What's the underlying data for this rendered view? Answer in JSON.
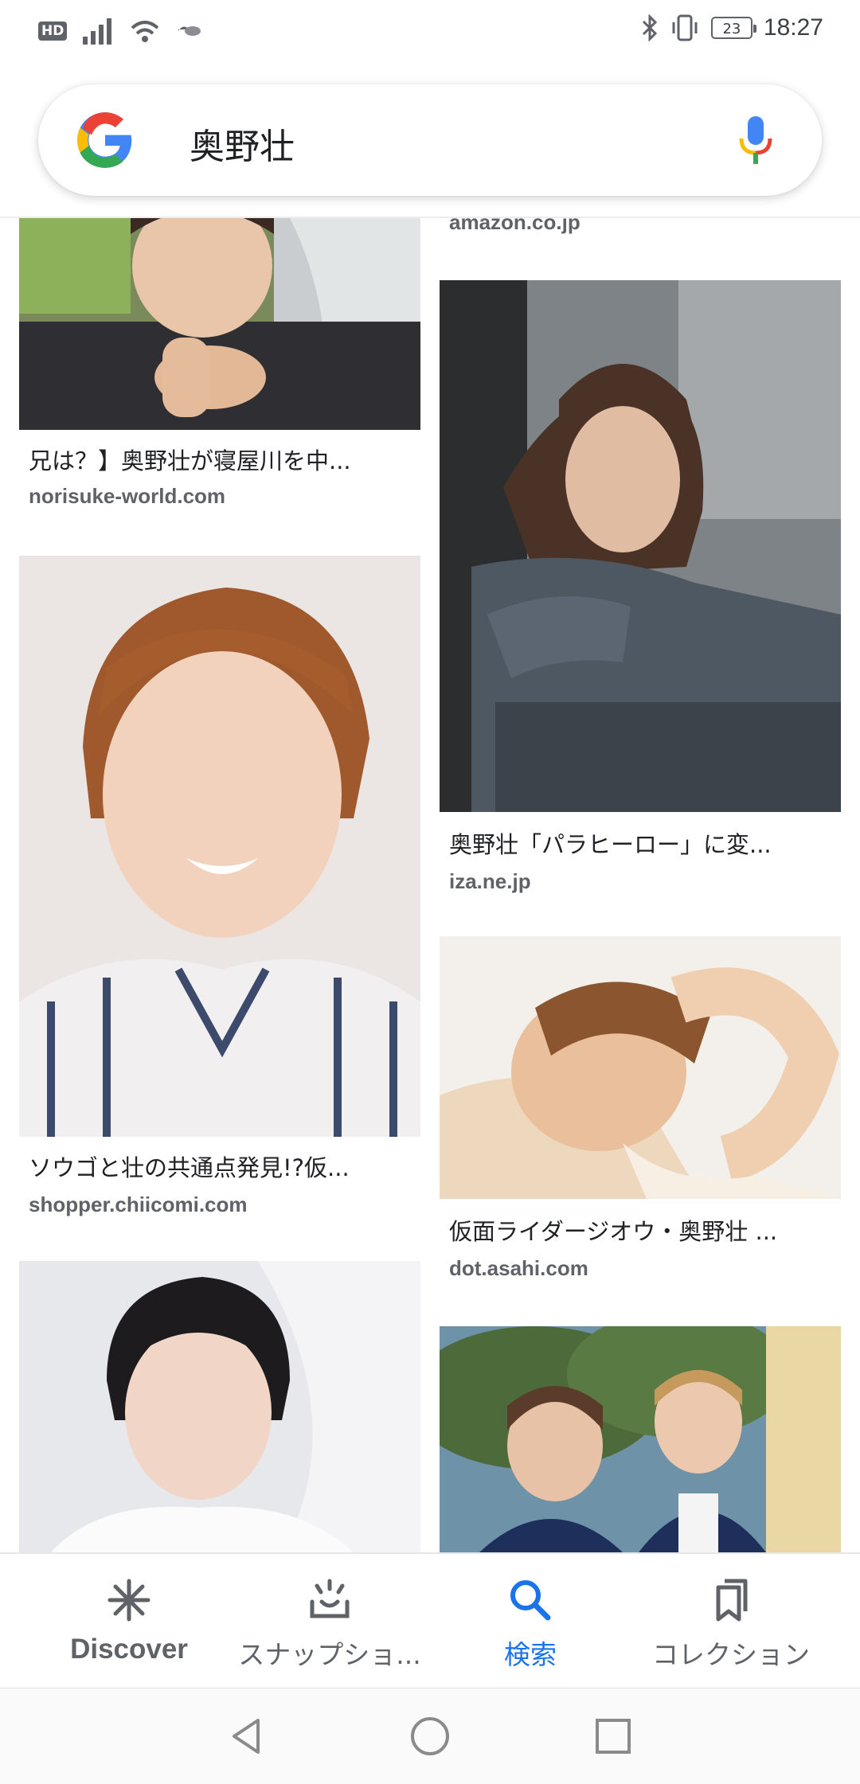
{
  "status_bar": {
    "hd": "HD",
    "battery": "23",
    "time": "18:27"
  },
  "search": {
    "query": "奥野壮"
  },
  "results": [
    {
      "title": "",
      "source": "amazon.co.jp"
    },
    {
      "title": "兄は？】奥野壮が寝屋川を中...",
      "source": "norisuke-world.com"
    },
    {
      "title": "奥野壮「パラヒーロー」に変...",
      "source": "iza.ne.jp"
    },
    {
      "title": "ソウゴと壮の共通点発見!?仮...",
      "source": "shopper.chiicomi.com"
    },
    {
      "title": "仮面ライダージオウ・奥野壮 ...",
      "source": "dot.asahi.com"
    }
  ],
  "bottom_nav": {
    "discover": "Discover",
    "snapshot": "スナップショ...",
    "search": "検索",
    "collections": "コレクション",
    "active": "search"
  },
  "colors": {
    "accent": "#1a73e8",
    "text_primary": "#202124",
    "text_secondary": "#5f6368"
  }
}
